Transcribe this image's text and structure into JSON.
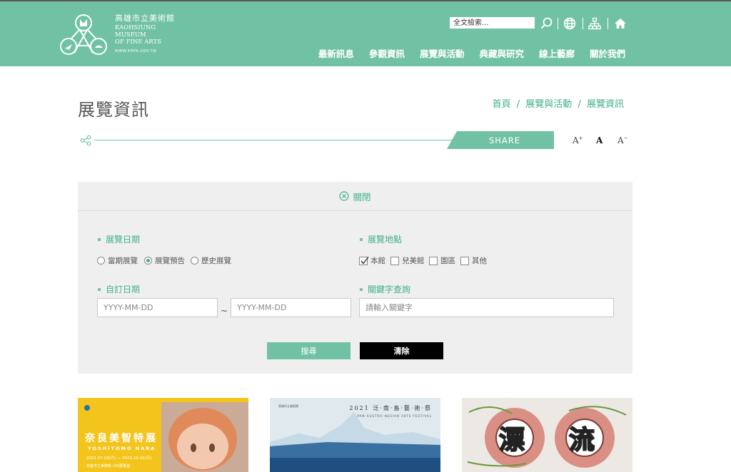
{
  "header": {
    "logo_zh": "高雄市立美術館",
    "logo_en_lines": [
      "KAOHSIUNG",
      "MUSEUM",
      "OF FINE ARTS"
    ],
    "logo_url": "WWW.KMFA.GOV.TW",
    "search_placeholder": "全文檢索...",
    "icons": [
      "search-icon",
      "globe-icon",
      "sitemap-icon",
      "home-icon"
    ],
    "nav": [
      "最新訊息",
      "參觀資訊",
      "展覽與活動",
      "典藏與研究",
      "線上藝廊",
      "關於我們"
    ]
  },
  "page": {
    "title": "展覽資訊",
    "breadcrumb": [
      "首頁",
      "展覽與活動",
      "展覽資訊"
    ],
    "breadcrumb_sep": "/",
    "share_label": "SHARE",
    "font_sizes": [
      "A",
      "A",
      "A"
    ]
  },
  "filter": {
    "close_label": "關閉",
    "date_label": "展覽日期",
    "date_options": [
      {
        "label": "當期展覽",
        "checked": false
      },
      {
        "label": "展覽預告",
        "checked": true
      },
      {
        "label": "歷史展覽",
        "checked": false
      }
    ],
    "location_label": "展覽地點",
    "location_options": [
      {
        "label": "本館",
        "checked": true
      },
      {
        "label": "兒美館",
        "checked": false
      },
      {
        "label": "園區",
        "checked": false
      },
      {
        "label": "其他",
        "checked": false
      }
    ],
    "custom_date_label": "自訂日期",
    "date_from_placeholder": "YYYY-MM-DD",
    "date_to_placeholder": "YYYY-MM-DD",
    "date_sep": "~",
    "keyword_label": "關鍵字查詢",
    "keyword_placeholder": "請輸入關鍵字",
    "search_button": "搜尋",
    "clear_button": "清除"
  },
  "cards": [
    {
      "title_zh": "奈良美智特展",
      "title_en": "YOSHITOMO NARA",
      "dates": "2021.07.24(六) — 2021.10.31(日)",
      "venue": "高雄市立美術館 105展覽室",
      "bg": "#f3c51c"
    },
    {
      "logo_text": "高雄市立美術館",
      "title_zh": "2021 泛·南·島·藝·術·祭",
      "title_en": "PAN-AUSTRO-NESIAN ARTS FESTIVAL",
      "bg": "#dfe9ee"
    },
    {
      "big_chars": [
        "漂",
        "流"
      ],
      "bg": "#ece8e4"
    }
  ],
  "colors": {
    "accent": "#71c2a5",
    "accent_text": "#3fb08a",
    "panel_bg": "#efefef"
  }
}
